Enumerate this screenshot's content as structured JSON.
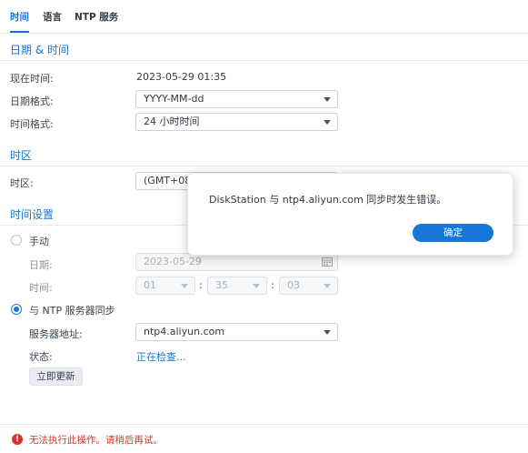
{
  "tabs": [
    {
      "label": "时间",
      "active": true
    },
    {
      "label": "语言",
      "active": false
    },
    {
      "label": "NTP 服务",
      "active": false
    }
  ],
  "datetime_section": {
    "title": "日期 & 时间",
    "current_time_label": "现在时间:",
    "current_time_value": "2023-05-29 01:35",
    "date_format_label": "日期格式:",
    "date_format_value": "YYYY-MM-dd",
    "time_format_label": "时间格式:",
    "time_format_value": "24 小时时间"
  },
  "timezone_section": {
    "title": "时区",
    "timezone_label": "时区:",
    "timezone_value": "(GMT+08:"
  },
  "time_settings": {
    "title": "时间设置",
    "manual_label": "手动",
    "manual_checked": false,
    "date_label": "日期:",
    "date_value": "2023-05-29",
    "time_label": "时间:",
    "hour_value": "01",
    "minute_value": "35",
    "second_value": "03",
    "colon": ":",
    "ntp_label": "与 NTP 服务器同步",
    "ntp_checked": true,
    "server_label": "服务器地址:",
    "server_value": "ntp4.aliyun.com",
    "status_label": "状态:",
    "status_value": "正在检查...",
    "update_button": "立即更新"
  },
  "error_bar": {
    "icon": "!",
    "message": "无法执行此操作。请稍后再试。"
  },
  "dialog": {
    "message": "DiskStation 与 ntp4.aliyun.com 同步时发生错误。",
    "ok_button": "确定"
  },
  "colors": {
    "accent": "#1877d6",
    "error": "#d9342b"
  }
}
